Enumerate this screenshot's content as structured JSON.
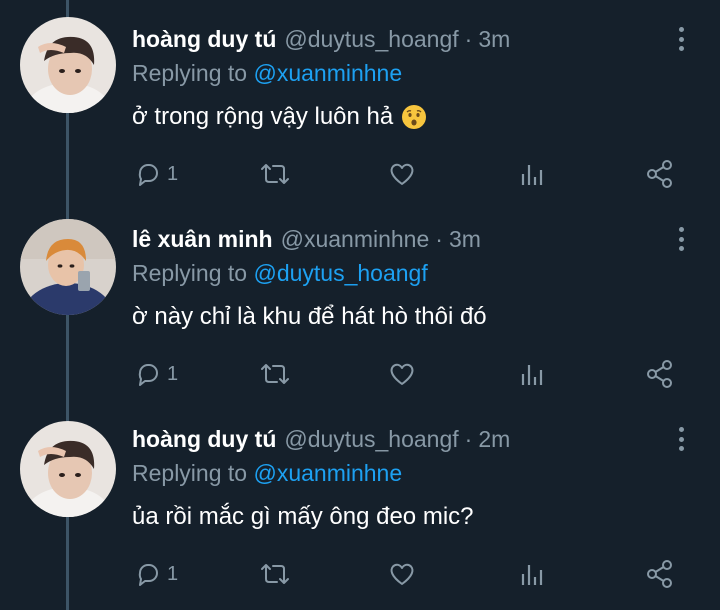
{
  "colors": {
    "background": "#15202b",
    "text": "#ffffff",
    "muted": "#8899a6",
    "link": "#1da1f2",
    "thread_line": "#3d5466"
  },
  "replies": [
    {
      "display_name": "hoàng duy tú",
      "handle": "@duytus_hoangf",
      "separator": "·",
      "time": "3m",
      "replying_label": "Replying to",
      "replying_to": "@xuanminhne",
      "text": "ở trong rộng vậy luôn hả",
      "emoji": "hushed-face",
      "reply_count": "1"
    },
    {
      "display_name": "lê xuân minh",
      "handle": "@xuanminhne",
      "separator": "·",
      "time": "3m",
      "replying_label": "Replying to",
      "replying_to": "@duytus_hoangf",
      "text": "ờ này chỉ là khu để hát hò thôi đó",
      "reply_count": "1"
    },
    {
      "display_name": "hoàng duy tú",
      "handle": "@duytus_hoangf",
      "separator": "·",
      "time": "2m",
      "replying_label": "Replying to",
      "replying_to": "@xuanminhne",
      "text": "ủa rồi mắc gì mấy ông đeo mic?",
      "reply_count": "1"
    }
  ],
  "icons": [
    "reply-icon",
    "retweet-icon",
    "like-icon",
    "analytics-icon",
    "share-icon",
    "more-options-icon"
  ]
}
